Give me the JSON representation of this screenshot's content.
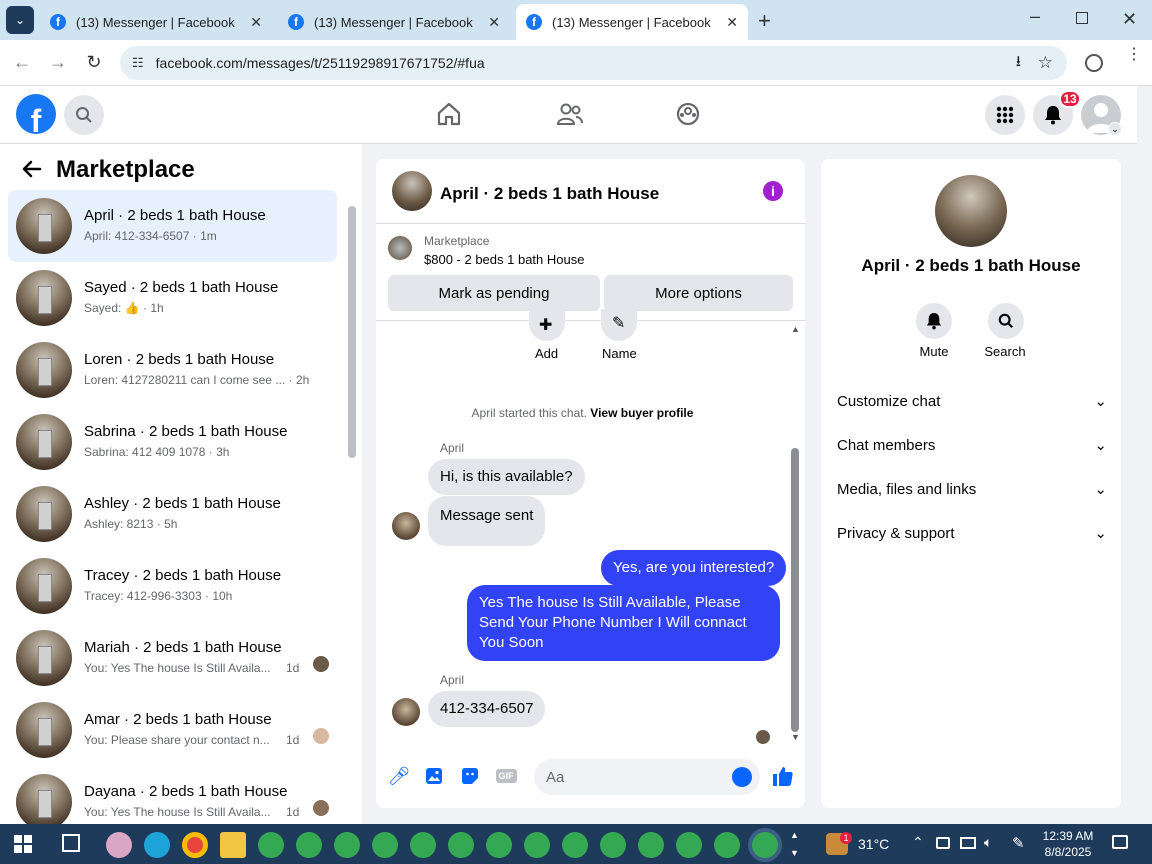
{
  "browser": {
    "tabs": [
      {
        "title": "(13) Messenger | Facebook"
      },
      {
        "title": "(13) Messenger | Facebook"
      },
      {
        "title": "(13) Messenger | Facebook"
      }
    ],
    "url": "facebook.com/messages/t/25119298917671752/#fua"
  },
  "header": {
    "notification_count": "13"
  },
  "sidebar": {
    "title": "Marketplace",
    "chats": [
      {
        "name": "April · 2 beds 1 bath House",
        "preview": "April: 412-334-6507",
        "time": "· 1m"
      },
      {
        "name": "Sayed · 2 beds 1 bath House",
        "preview": "Sayed:",
        "time": "· 1h"
      },
      {
        "name": "Loren · 2 beds 1 bath House",
        "preview": "Loren: 4127280211 can I come see ...",
        "time": "· 2h"
      },
      {
        "name": "Sabrina · 2 beds 1 bath House",
        "preview": "Sabrina: 412 409 1078",
        "time": "· 3h"
      },
      {
        "name": "Ashley · 2 beds 1 bath House",
        "preview": "Ashley: 8213",
        "time": "· 5h"
      },
      {
        "name": "Tracey · 2 beds 1 bath House",
        "preview": "Tracey: 412-996-3303",
        "time": "· 10h"
      },
      {
        "name": "Mariah · 2 beds 1 bath House",
        "preview": "You: Yes The house Is Still Availa...",
        "time": "1d"
      },
      {
        "name": "Amar · 2 beds 1 bath House",
        "preview": "You: Please share your contact n...",
        "time": "1d"
      },
      {
        "name": "Dayana · 2 beds 1 bath House",
        "preview": "You: Yes The house Is Still Availa...",
        "time": "1d"
      }
    ]
  },
  "chat": {
    "title": "April · 2 beds 1 bath House",
    "marketplace_label": "Marketplace",
    "listing": "$800 - 2 beds 1 bath House",
    "mark_pending": "Mark as pending",
    "more_options": "More options",
    "add_label": "Add",
    "name_label": "Name",
    "started_text": "April started this chat.",
    "view_profile": "View buyer profile",
    "messages": [
      {
        "sender": "April",
        "text": "Hi, is this available?"
      },
      {
        "text": "Message sent"
      },
      {
        "text": "Yes, are you interested?"
      },
      {
        "text": "Yes The house Is Still Available, Please Send Your Phone Number I Will connact You Soon"
      },
      {
        "sender": "April",
        "text": "412-334-6507"
      }
    ],
    "input_placeholder": "Aa"
  },
  "details": {
    "name": "April · 2 beds 1 bath House",
    "mute": "Mute",
    "search": "Search",
    "sections": [
      "Customize chat",
      "Chat members",
      "Media, files and links",
      "Privacy & support"
    ]
  },
  "taskbar": {
    "temperature": "31°C",
    "time": "12:39 AM",
    "date": "8/8/2025",
    "weather_badge": "1"
  },
  "colors": {
    "accent": "#1877f2",
    "outgoing_bubble": "#3243f5",
    "badge": "#e41e3f"
  }
}
